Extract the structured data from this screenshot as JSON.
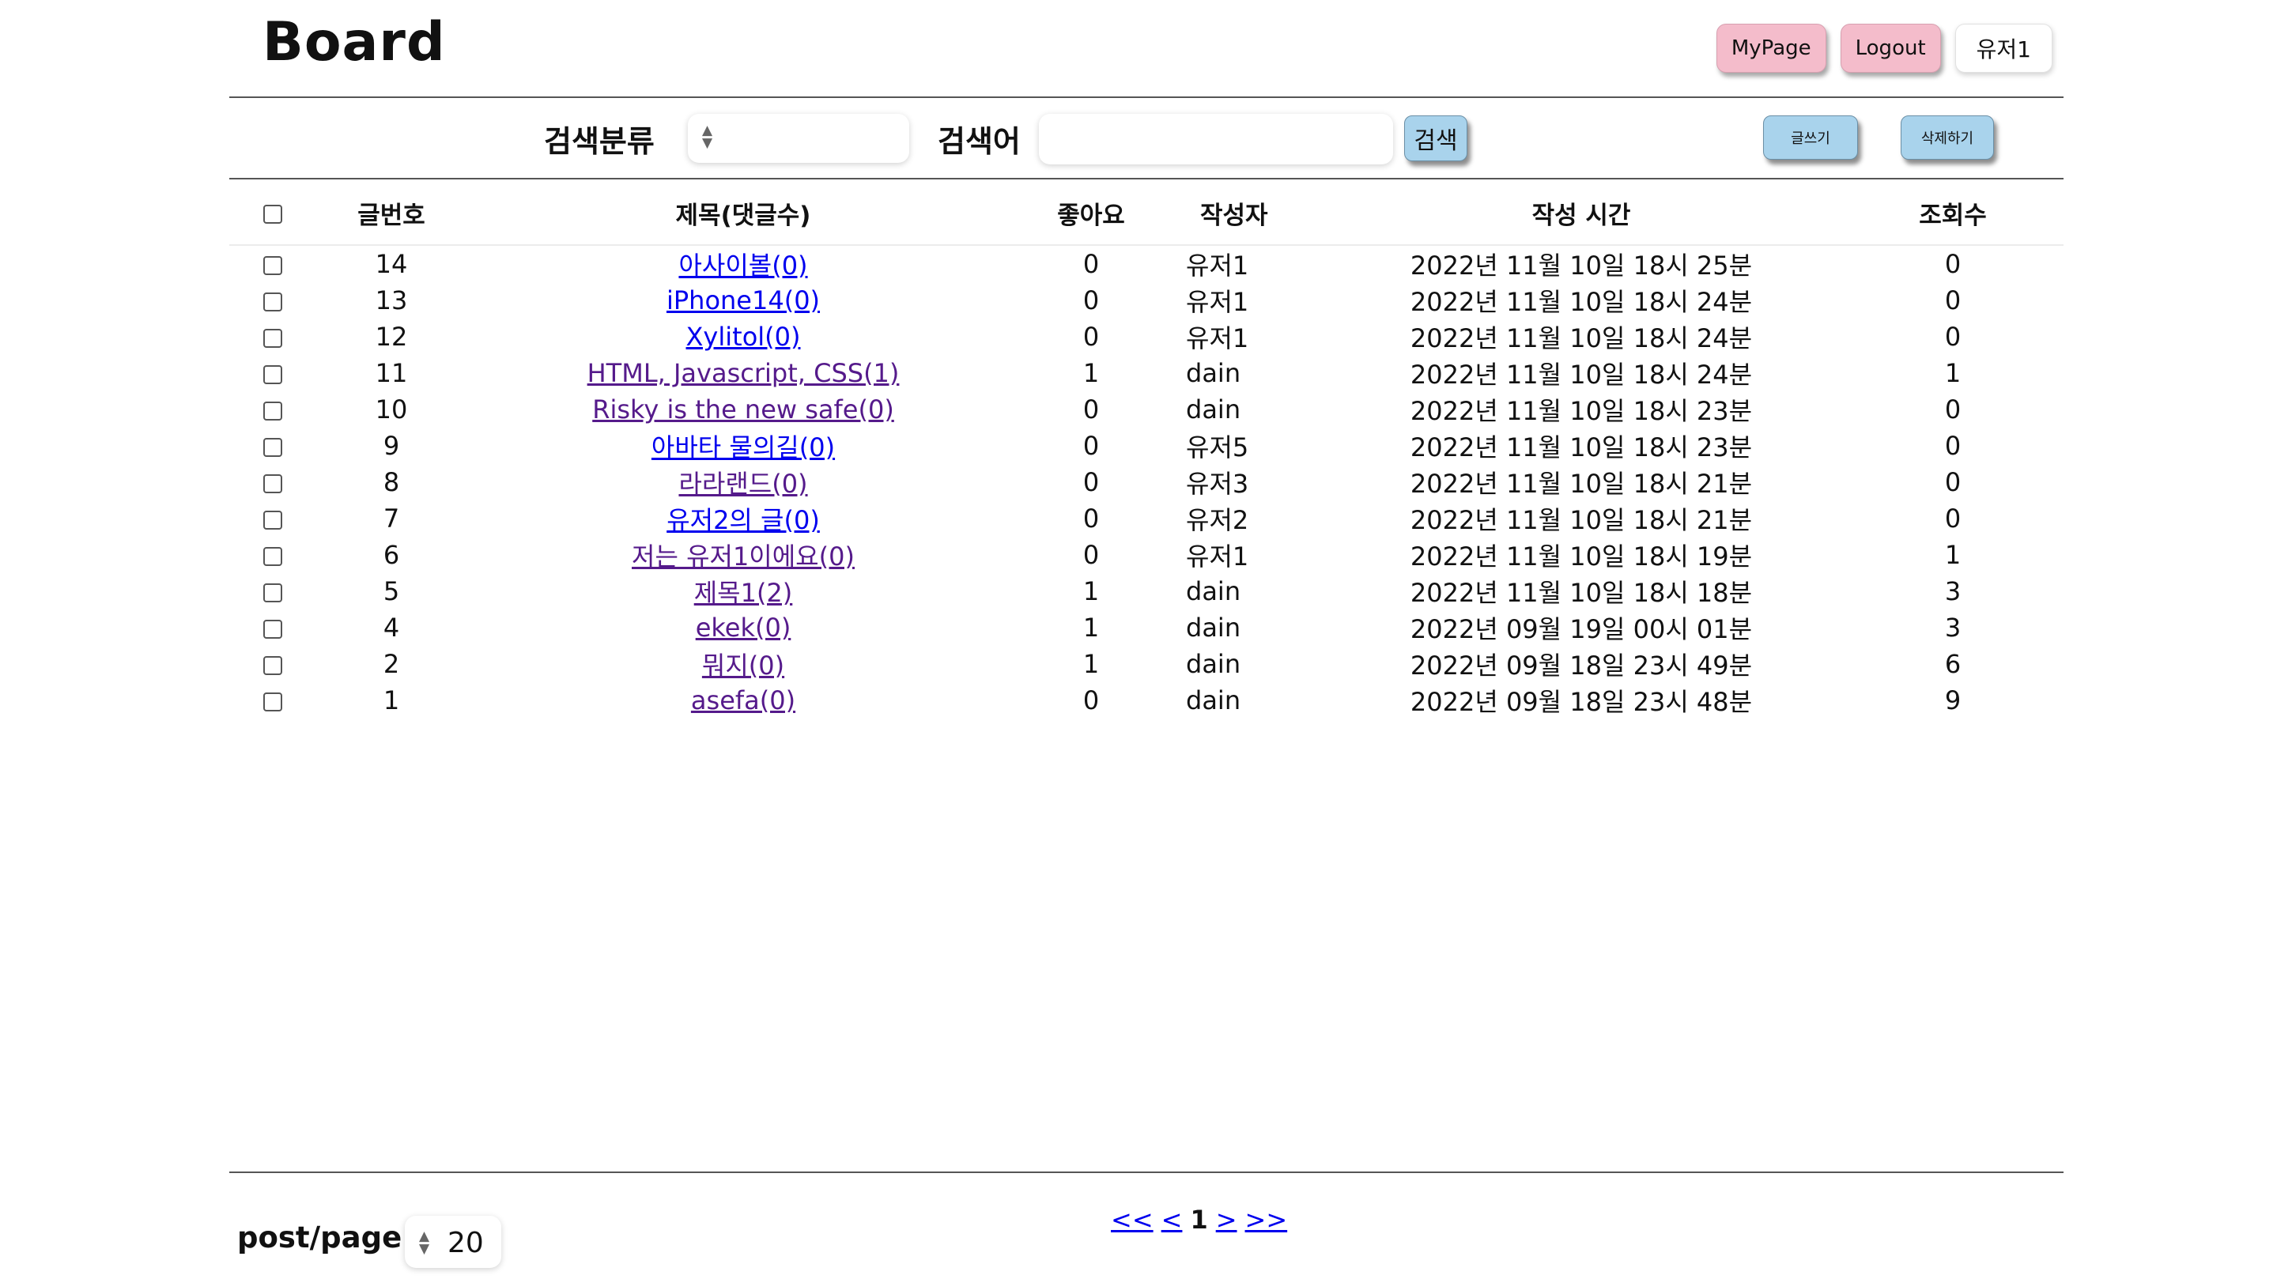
{
  "header": {
    "title": "Board",
    "mypage_label": "MyPage",
    "logout_label": "Logout",
    "username": "유저1"
  },
  "search": {
    "category_label": "검색분류",
    "category_value": "",
    "keyword_label": "검색어",
    "keyword_value": "",
    "search_button": "검색",
    "write_button": "글쓰기",
    "delete_button": "삭제하기"
  },
  "table": {
    "columns": [
      "글번호",
      "제목(댓글수)",
      "좋아요",
      "작성자",
      "작성 시간",
      "조회수"
    ],
    "rows": [
      {
        "no": "14",
        "title": "아사이볼(0)",
        "likes": "0",
        "writer": "유저1",
        "time": "2022년 11월 10일 18시 25분",
        "views": "0"
      },
      {
        "no": "13",
        "title": "iPhone14(0)",
        "likes": "0",
        "writer": "유저1",
        "time": "2022년 11월 10일 18시 24분",
        "views": "0"
      },
      {
        "no": "12",
        "title": "Xylitol(0)",
        "likes": "0",
        "writer": "유저1",
        "time": "2022년 11월 10일 18시 24분",
        "views": "0"
      },
      {
        "no": "11",
        "title": "HTML, Javascript, CSS(1)",
        "likes": "1",
        "writer": "dain",
        "time": "2022년 11월 10일 18시 24분",
        "views": "1"
      },
      {
        "no": "10",
        "title": "Risky is the new safe(0)",
        "likes": "0",
        "writer": "dain",
        "time": "2022년 11월 10일 18시 23분",
        "views": "0"
      },
      {
        "no": "9",
        "title": "아바타 물의길(0)",
        "likes": "0",
        "writer": "유저5",
        "time": "2022년 11월 10일 18시 23분",
        "views": "0"
      },
      {
        "no": "8",
        "title": "라라랜드(0)",
        "likes": "0",
        "writer": "유저3",
        "time": "2022년 11월 10일 18시 21분",
        "views": "0"
      },
      {
        "no": "7",
        "title": "유저2의 글(0)",
        "likes": "0",
        "writer": "유저2",
        "time": "2022년 11월 10일 18시 21분",
        "views": "0"
      },
      {
        "no": "6",
        "title": "저는 유저1이에요(0)",
        "likes": "0",
        "writer": "유저1",
        "time": "2022년 11월 10일 18시 19분",
        "views": "1"
      },
      {
        "no": "5",
        "title": "제목1(2)",
        "likes": "1",
        "writer": "dain",
        "time": "2022년 11월 10일 18시 18분",
        "views": "3"
      },
      {
        "no": "4",
        "title": "ekek(0)",
        "likes": "1",
        "writer": "dain",
        "time": "2022년 09월 19일 00시 01분",
        "views": "3"
      },
      {
        "no": "2",
        "title": "뭐지(0)",
        "likes": "1",
        "writer": "dain",
        "time": "2022년 09월 18일 23시 49분",
        "views": "6"
      },
      {
        "no": "1",
        "title": "asefa(0)",
        "likes": "0",
        "writer": "dain",
        "time": "2022년 09월 18일 23시 48분",
        "views": "9"
      }
    ],
    "visited_rows": [
      3,
      4,
      6,
      8,
      9,
      10,
      11,
      12
    ]
  },
  "footer": {
    "per_page_label": "post/page",
    "per_page_value": "20",
    "first": "<<",
    "prev": "<",
    "current_page": "1",
    "next": ">",
    "last": ">>"
  }
}
